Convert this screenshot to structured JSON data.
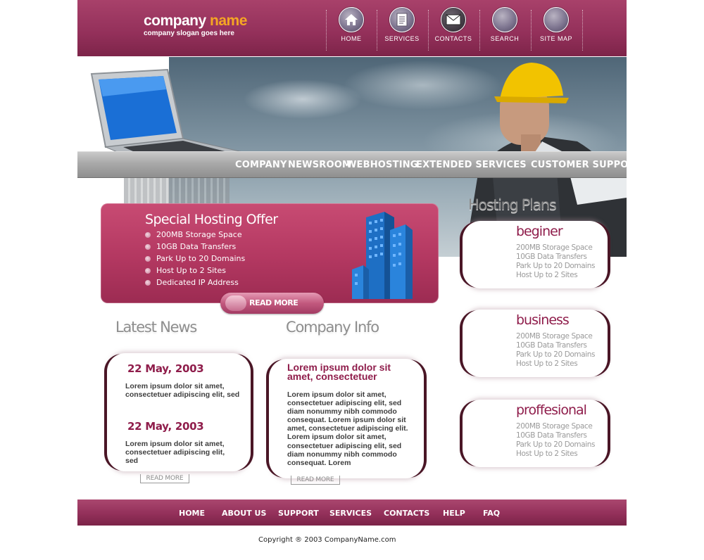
{
  "header": {
    "company_name_part1": "company",
    "company_name_part2": "name",
    "slogan": "company slogan goes here",
    "nav": [
      {
        "label": "HOME",
        "icon": "home-icon"
      },
      {
        "label": "SERVICES",
        "icon": "document-icon"
      },
      {
        "label": "CONTACTS",
        "icon": "envelope-icon"
      },
      {
        "label": "SEARCH",
        "icon": "search-icon"
      },
      {
        "label": "SITE MAP",
        "icon": "sitemap-icon"
      }
    ]
  },
  "main_nav": [
    "COMPANY",
    "NEWSROOM",
    "WEBHOSTING",
    "EXTENDED SERVICES",
    "CUSTOMER SUPPORT"
  ],
  "offer": {
    "title": "Special Hosting Offer",
    "items": [
      "200MB Storage Space",
      "10GB Data Transfers",
      "Park Up to 20 Domains",
      "Host Up to 2 Sites",
      "Dedicated IP Address"
    ],
    "read_more": "READ MORE"
  },
  "latest_news": {
    "title": "Latest News",
    "items": [
      {
        "date": "22 May, 2003",
        "text": "Lorem ipsum dolor sit amet, consectetuer adipiscing elit, sed"
      },
      {
        "date": "22 May, 2003",
        "text": "Lorem ipsum dolor sit amet, consectetuer adipiscing elit, sed"
      }
    ],
    "read_more": "READ MORE"
  },
  "company_info": {
    "title": "Company Info",
    "heading": "Lorem ipsum dolor sit amet, consectetuer",
    "text": "Lorem ipsum dolor sit amet, consectetuer adipiscing elit, sed diam nonummy nibh commodo consequat. Lorem ipsum dolor sit amet, consectetuer adipiscing elit. Lorem ipsum dolor sit amet, consectetuer adipiscing elit, sed diam nonummy nibh commodo consequat. Lorem",
    "read_more": "READ MORE"
  },
  "plans": {
    "title": "Hosting Plans",
    "items": [
      {
        "name": "beginer",
        "features": [
          "200MB Storage Space",
          "10GB Data Transfers",
          "Park Up to 20 Domains",
          "Host Up to 2 Sites"
        ]
      },
      {
        "name": "business",
        "features": [
          "200MB Storage Space",
          "10GB Data Transfers",
          "Park Up to 20 Domains",
          "Host Up to 2 Sites"
        ]
      },
      {
        "name": "proffesional",
        "features": [
          "200MB Storage Space",
          "10GB Data Transfers",
          "Park Up to 20 Domains",
          "Host Up to 2 Sites"
        ]
      }
    ]
  },
  "footer": {
    "nav": [
      "HOME",
      "ABOUT US",
      "SUPPORT",
      "SERVICES",
      "CONTACTS",
      "HELP",
      "FAQ"
    ],
    "copyright": "Copyright ® 2003 CompanyName.com"
  },
  "colors": {
    "brand": "#93305a",
    "accent": "#f5a623",
    "heading": "#8f1d4b"
  }
}
